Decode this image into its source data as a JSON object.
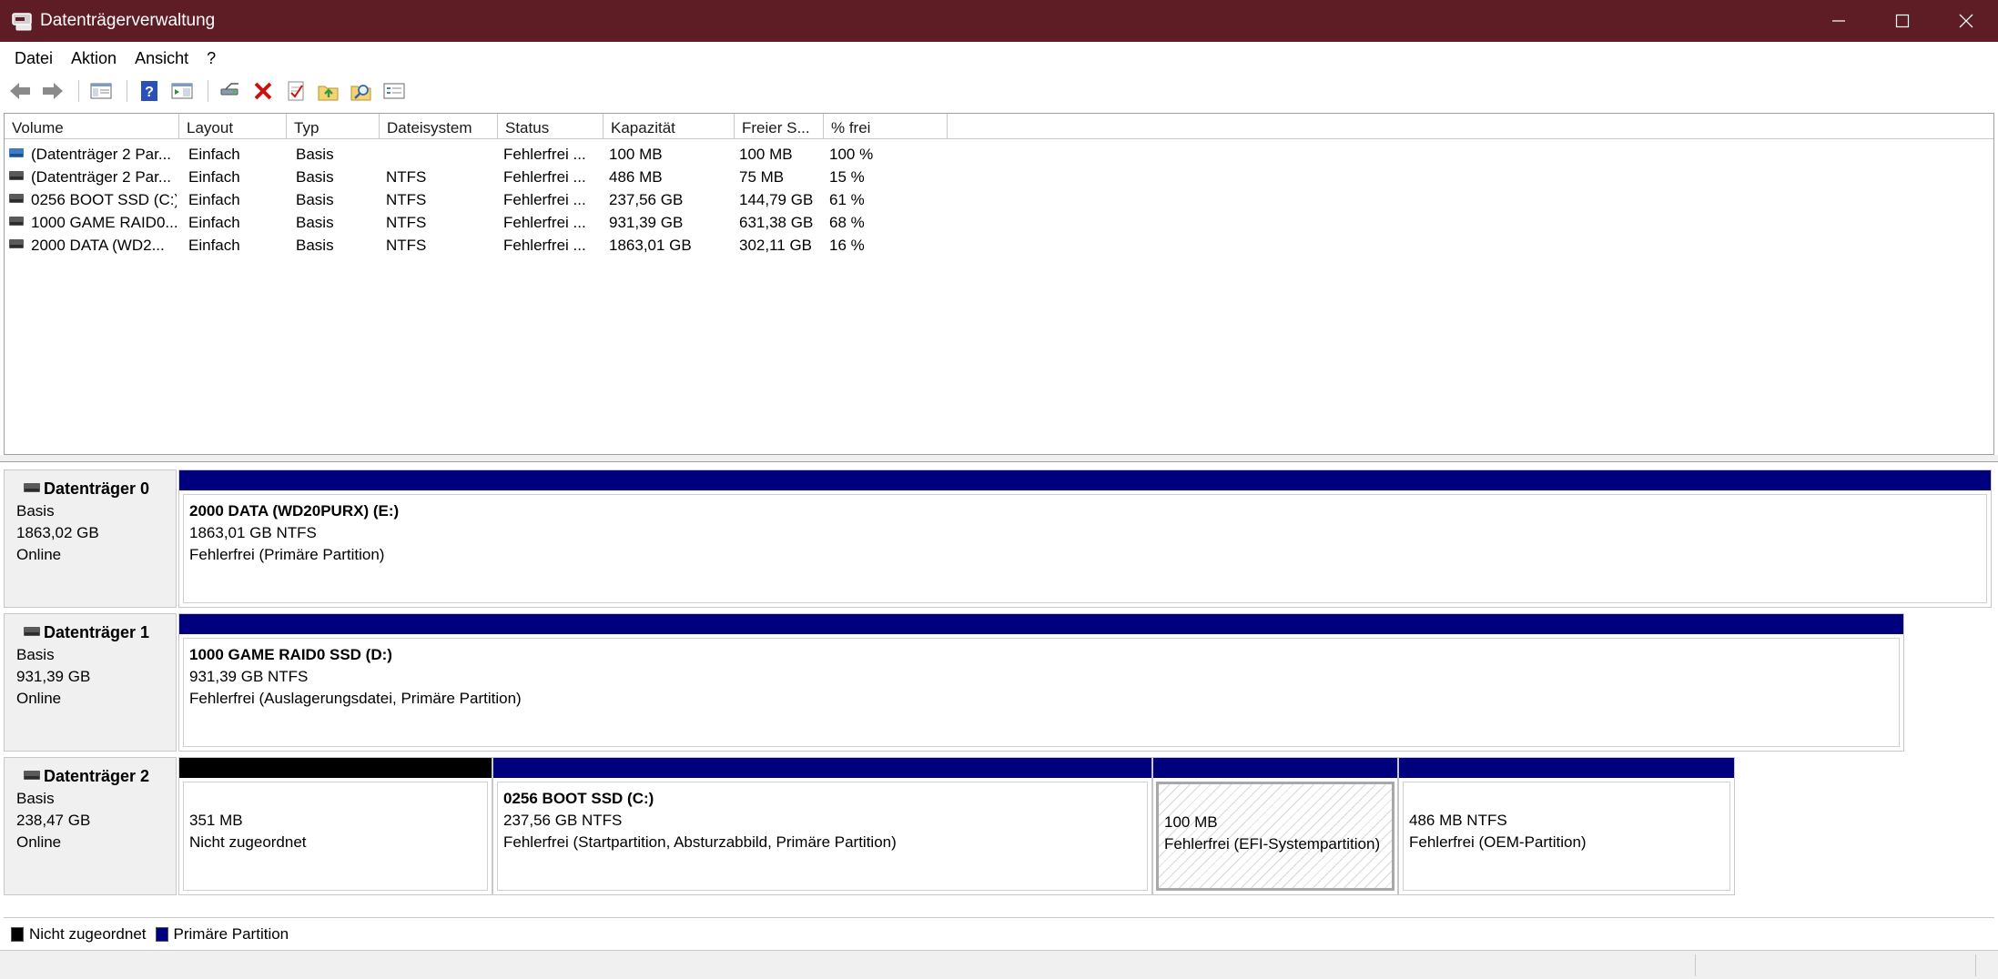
{
  "window": {
    "title": "Datenträgerverwaltung"
  },
  "colors": {
    "titlebar": "#5e1d24",
    "primary_partition": "#00007f",
    "unallocated": "#000000"
  },
  "menu": [
    "Datei",
    "Aktion",
    "Ansicht",
    "?"
  ],
  "toolbar_icons": [
    "back-icon",
    "forward-icon",
    "console-tree-icon",
    "help-icon",
    "properties-icon",
    "connect-disk-icon",
    "delete-icon",
    "checklist-icon",
    "folder-up-icon",
    "search-folder-icon",
    "details-icon"
  ],
  "volumes": {
    "headers": [
      "Volume",
      "Layout",
      "Typ",
      "Dateisystem",
      "Status",
      "Kapazität",
      "Freier S...",
      "% frei"
    ],
    "rows": [
      [
        "(Datenträger 2 Par...",
        "Einfach",
        "Basis",
        "",
        "Fehlerfrei ...",
        "100 MB",
        "100 MB",
        "100 %"
      ],
      [
        "(Datenträger 2 Par...",
        "Einfach",
        "Basis",
        "NTFS",
        "Fehlerfrei ...",
        "486 MB",
        "75 MB",
        "15 %"
      ],
      [
        "0256 BOOT SSD (C:)",
        "Einfach",
        "Basis",
        "NTFS",
        "Fehlerfrei ...",
        "237,56 GB",
        "144,79 GB",
        "61 %"
      ],
      [
        "1000 GAME RAID0...",
        "Einfach",
        "Basis",
        "NTFS",
        "Fehlerfrei ...",
        "931,39 GB",
        "631,38 GB",
        "68 %"
      ],
      [
        "2000 DATA (WD2...",
        "Einfach",
        "Basis",
        "NTFS",
        "Fehlerfrei ...",
        "1863,01 GB",
        "302,11 GB",
        "16 %"
      ]
    ]
  },
  "disks": [
    {
      "name": "Datenträger 0",
      "type": "Basis",
      "size": "1863,02 GB",
      "state": "Online",
      "partitions": [
        {
          "name": "2000 DATA (WD20PURX)  (E:)",
          "line1": "1863,01 GB NTFS",
          "line2": "Fehlerfrei (Primäre Partition)",
          "kind": "primary"
        }
      ]
    },
    {
      "name": "Datenträger 1",
      "type": "Basis",
      "size": "931,39 GB",
      "state": "Online",
      "partitions": [
        {
          "name": "1000 GAME RAID0 SSD  (D:)",
          "line1": "931,39 GB NTFS",
          "line2": "Fehlerfrei (Auslagerungsdatei, Primäre Partition)",
          "kind": "primary"
        }
      ]
    },
    {
      "name": "Datenträger 2",
      "type": "Basis",
      "size": "238,47 GB",
      "state": "Online",
      "partitions": [
        {
          "name": "",
          "line1": "351 MB",
          "line2": "Nicht zugeordnet",
          "kind": "unallocated"
        },
        {
          "name": "0256 BOOT SSD  (C:)",
          "line1": "237,56 GB NTFS",
          "line2": "Fehlerfrei (Startpartition, Absturzabbild, Primäre Partition)",
          "kind": "primary"
        },
        {
          "name": "",
          "line1": "100 MB",
          "line2": "Fehlerfrei (EFI-Systempartition)",
          "kind": "primary-selected"
        },
        {
          "name": "",
          "line1": "486 MB NTFS",
          "line2": "Fehlerfrei (OEM-Partition)",
          "kind": "primary"
        }
      ]
    }
  ],
  "legend": [
    "Nicht zugeordnet",
    "Primäre Partition"
  ]
}
